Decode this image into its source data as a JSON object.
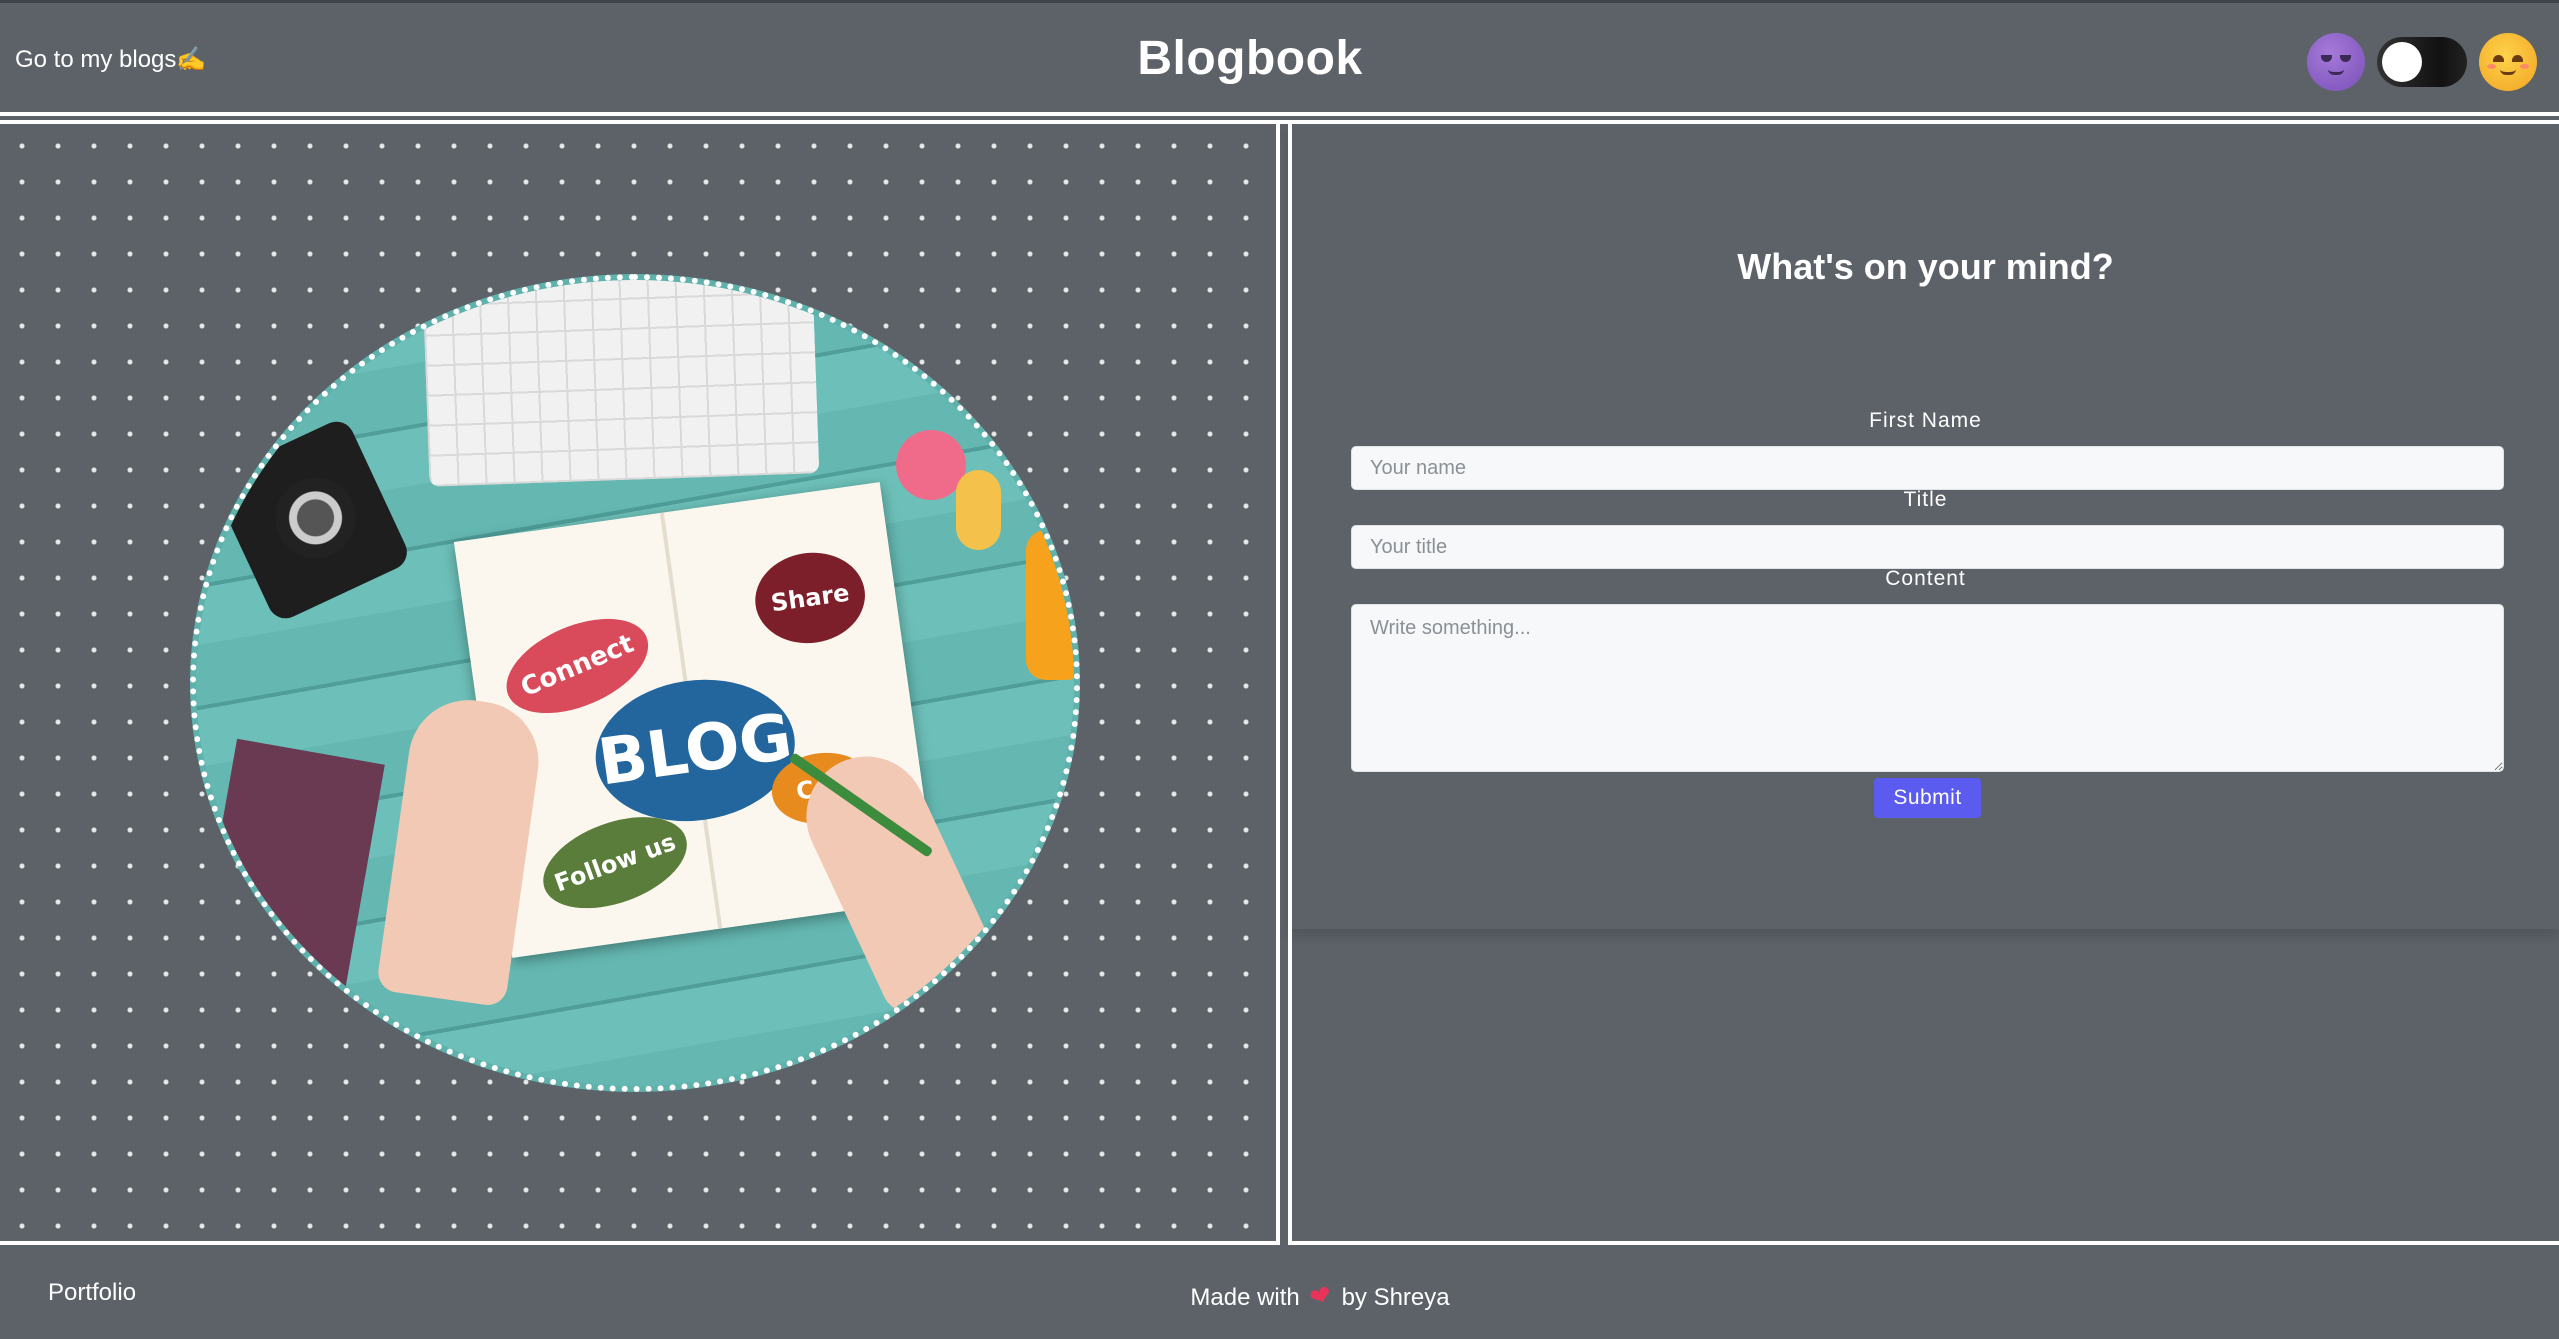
{
  "header": {
    "goto_label": "Go to my blogs✍️",
    "brand": "Blogbook",
    "theme_toggle": {
      "state": "off",
      "left_icon": "sleepy-moon-emoji-icon",
      "right_icon": "smiling-sun-emoji-icon"
    }
  },
  "hero": {
    "image_icon": "blog-concept-photo",
    "notebook_words": [
      "Connect",
      "Share",
      "BLOG",
      "Follow us",
      "Con"
    ]
  },
  "form": {
    "title": "What's on your mind?",
    "first_name_label": "First Name",
    "first_name_placeholder": "Your name",
    "title_label": "Title",
    "title_placeholder": "Your title",
    "content_label": "Content",
    "content_placeholder": "Write something...",
    "submit_label": "Submit"
  },
  "footer": {
    "portfolio_label": "Portfolio",
    "made_with_prefix": "Made with",
    "made_with_suffix": "by Shreya",
    "heart_icon": "heart-icon"
  },
  "colors": {
    "background": "#5c6268",
    "accent_button": "#5b5bf0",
    "heart": "#e8335a",
    "border": "#ffffff"
  }
}
